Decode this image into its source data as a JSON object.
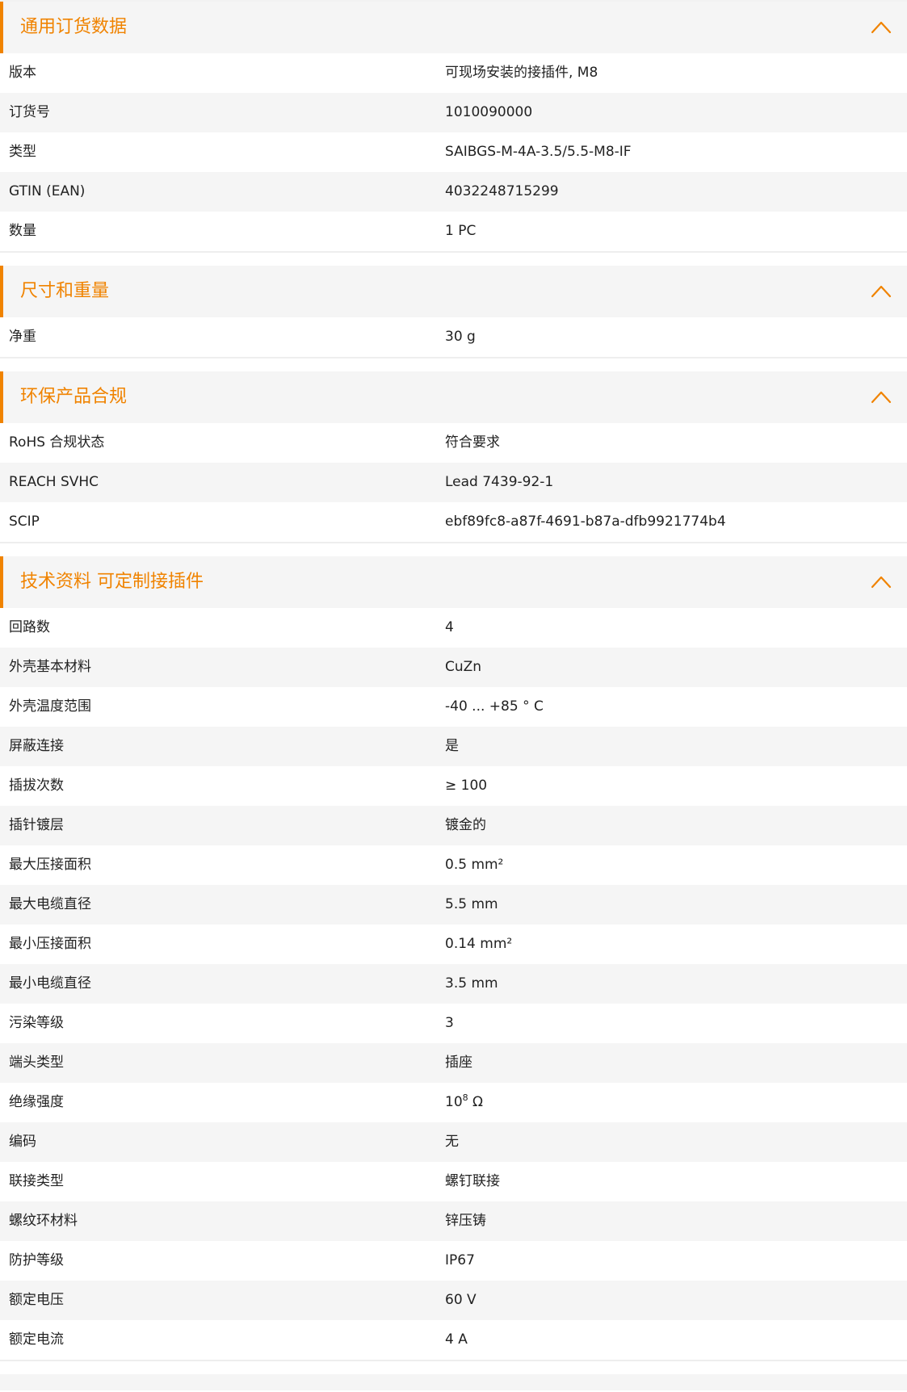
{
  "colors": {
    "accent": "#f08300",
    "row_alt": "#f5f5f5",
    "text": "#222222"
  },
  "sections": [
    {
      "title": "通用订货数据",
      "icon": "chevron-up-icon",
      "rows": [
        {
          "label": "版本",
          "value": "可现场安装的接插件, M8"
        },
        {
          "label": "订货号",
          "value": "1010090000"
        },
        {
          "label": "类型",
          "value": "SAIBGS-M-4A-3.5/5.5-M8-IF"
        },
        {
          "label": "GTIN (EAN)",
          "value": "4032248715299"
        },
        {
          "label": "数量",
          "value": "1  PC"
        }
      ]
    },
    {
      "title": "尺寸和重量",
      "icon": "chevron-up-icon",
      "rows": [
        {
          "label": "净重",
          "value": "30  g"
        }
      ]
    },
    {
      "title": "环保产品合规",
      "icon": "chevron-up-icon",
      "rows": [
        {
          "label": "RoHS 合规状态",
          "value": "符合要求"
        },
        {
          "label": "REACH SVHC",
          "value": "Lead 7439-92-1"
        },
        {
          "label": "SCIP",
          "value": "ebf89fc8-a87f-4691-b87a-dfb9921774b4"
        }
      ]
    },
    {
      "title": "技术资料 可定制接插件",
      "icon": "chevron-up-icon",
      "rows": [
        {
          "label": "回路数",
          "value": "4"
        },
        {
          "label": "外壳基本材料",
          "value": "CuZn"
        },
        {
          "label": "外壳温度范围",
          "value": "-40 ... +85 ° C"
        },
        {
          "label": "屏蔽连接",
          "value": "是"
        },
        {
          "label": "插拔次数",
          "value": "≥ 100"
        },
        {
          "label": "插针镀层",
          "value": "镀金的"
        },
        {
          "label": "最大压接面积",
          "value": "0.5  mm²"
        },
        {
          "label": "最大电缆直径",
          "value": "5.5  mm"
        },
        {
          "label": "最小压接面积",
          "value": "0.14  mm²"
        },
        {
          "label": "最小电缆直径",
          "value": "3.5  mm"
        },
        {
          "label": "污染等级",
          "value": "3"
        },
        {
          "label": "端头类型",
          "value": "插座"
        },
        {
          "label": "绝缘强度",
          "value": "10",
          "value_sup": "8",
          "value_suffix": " Ω"
        },
        {
          "label": "编码",
          "value": "无"
        },
        {
          "label": "联接类型",
          "value": "螺钉联接"
        },
        {
          "label": "螺纹环材料",
          "value": "锌压铸"
        },
        {
          "label": "防护等级",
          "value": "IP67"
        },
        {
          "label": "额定电压",
          "value": "60  V"
        },
        {
          "label": "额定电流",
          "value": "4  A"
        }
      ]
    }
  ]
}
